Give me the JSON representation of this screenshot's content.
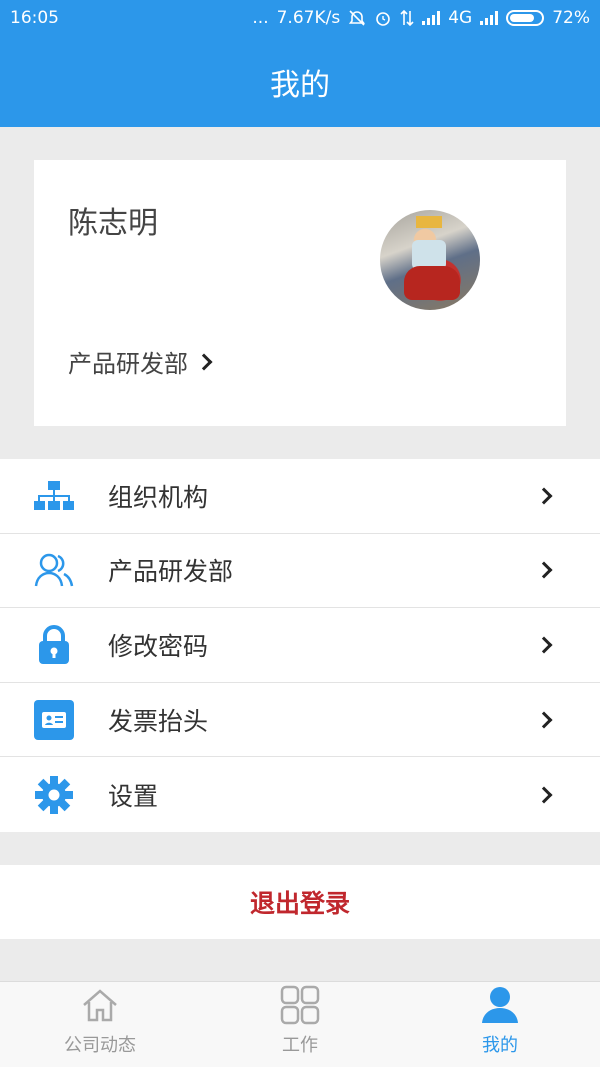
{
  "status_bar": {
    "time": "16:05",
    "dots": "...",
    "speed": "7.67K/s",
    "network": "4G",
    "battery": "72%"
  },
  "header": {
    "title": "我的"
  },
  "profile": {
    "name": "陈志明",
    "department": "产品研发部"
  },
  "menu": {
    "items": [
      {
        "label": "组织机构",
        "icon": "org-chart-icon"
      },
      {
        "label": "产品研发部",
        "icon": "users-icon"
      },
      {
        "label": "修改密码",
        "icon": "lock-icon"
      },
      {
        "label": "发票抬头",
        "icon": "id-card-icon"
      },
      {
        "label": "设置",
        "icon": "gear-icon"
      }
    ]
  },
  "logout_label": "退出登录",
  "tabs": [
    {
      "label": "公司动态",
      "icon": "home-icon",
      "active": false
    },
    {
      "label": "工作",
      "icon": "grid-icon",
      "active": false
    },
    {
      "label": "我的",
      "icon": "person-icon",
      "active": true
    }
  ],
  "colors": {
    "primary": "#2c97ea",
    "logout": "#c0272d",
    "background": "#ebebeb"
  }
}
